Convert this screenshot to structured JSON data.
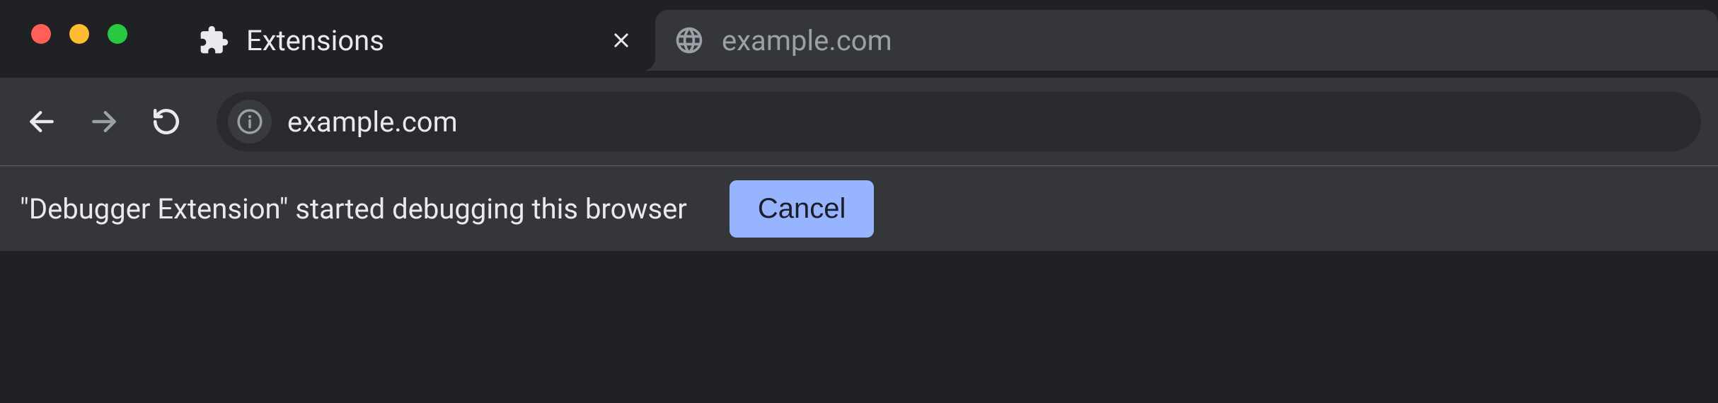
{
  "tabs": [
    {
      "title": "Extensions",
      "favicon": "puzzle-piece-icon",
      "active": false,
      "closable": true
    },
    {
      "title": "example.com",
      "favicon": "globe-icon",
      "active": true,
      "closable": false
    }
  ],
  "toolbar": {
    "back_enabled": true,
    "forward_enabled": false,
    "address_value": "example.com"
  },
  "infobar": {
    "message": "\"Debugger Extension\" started debugging this browser",
    "cancel_label": "Cancel"
  }
}
